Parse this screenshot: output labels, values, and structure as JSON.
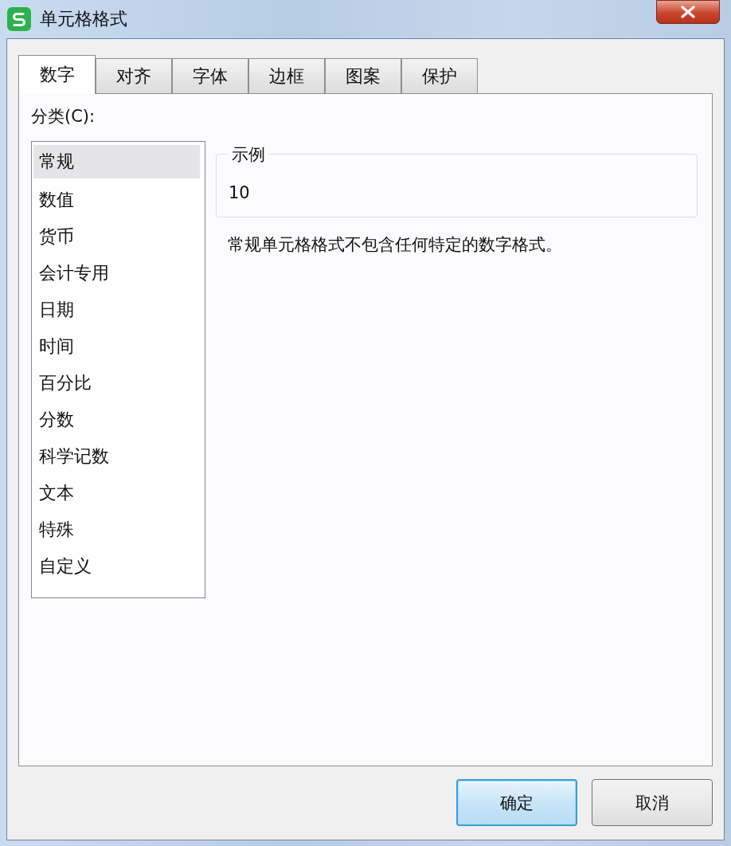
{
  "window": {
    "title": "单元格格式"
  },
  "tabs": [
    {
      "label": "数字",
      "selected": true
    },
    {
      "label": "对齐",
      "selected": false
    },
    {
      "label": "字体",
      "selected": false
    },
    {
      "label": "边框",
      "selected": false
    },
    {
      "label": "图案",
      "selected": false
    },
    {
      "label": "保护",
      "selected": false
    }
  ],
  "category": {
    "label": "分类(C):",
    "items": [
      {
        "label": "常规",
        "selected": true
      },
      {
        "label": "数值",
        "selected": false
      },
      {
        "label": "货币",
        "selected": false
      },
      {
        "label": "会计专用",
        "selected": false
      },
      {
        "label": "日期",
        "selected": false
      },
      {
        "label": "时间",
        "selected": false
      },
      {
        "label": "百分比",
        "selected": false
      },
      {
        "label": "分数",
        "selected": false
      },
      {
        "label": "科学记数",
        "selected": false
      },
      {
        "label": "文本",
        "selected": false
      },
      {
        "label": "特殊",
        "selected": false
      },
      {
        "label": "自定义",
        "selected": false
      }
    ]
  },
  "sample": {
    "label": "示例",
    "value": "10"
  },
  "description": "常规单元格格式不包含任何特定的数字格式。",
  "buttons": [
    {
      "label": "确定",
      "kind": "default"
    },
    {
      "label": "取消",
      "kind": "normal"
    }
  ]
}
